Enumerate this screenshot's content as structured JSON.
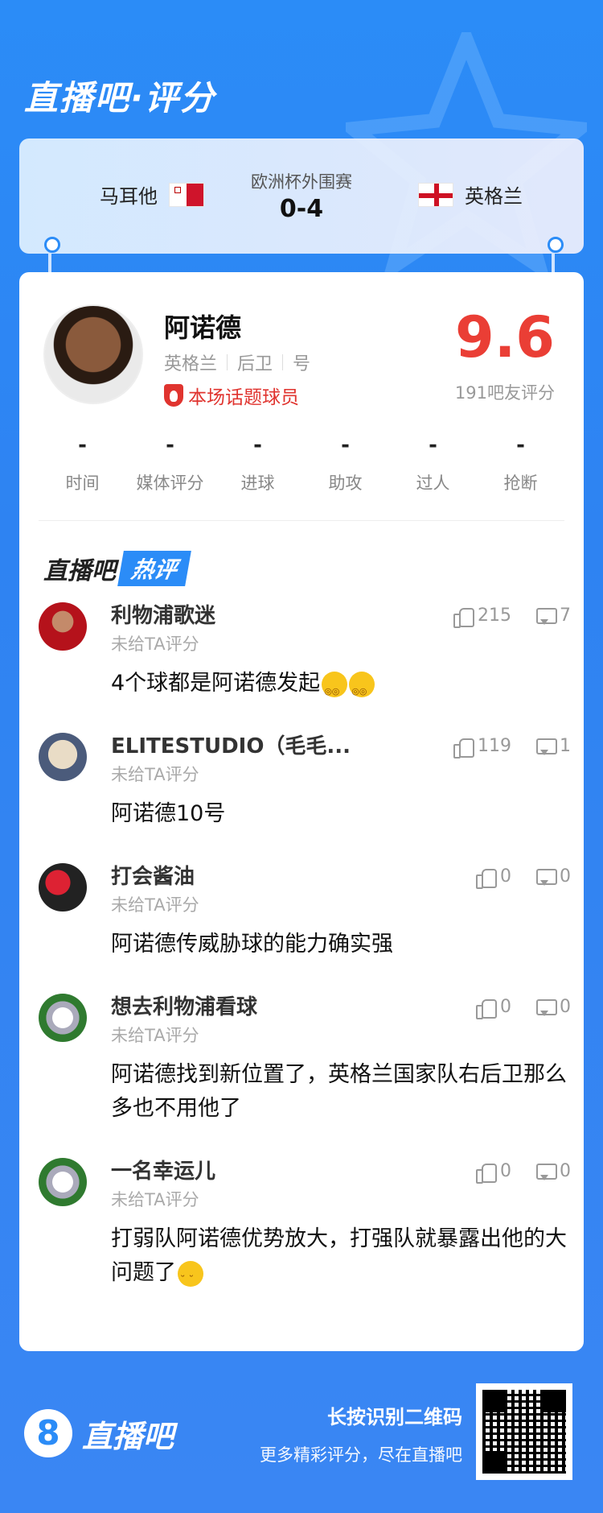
{
  "brand": {
    "title": "直播吧·评分"
  },
  "match": {
    "competition": "欧洲杯外围赛",
    "score": "0-4",
    "home": {
      "name": "马耳他",
      "flag": "flag-malta-icon"
    },
    "away": {
      "name": "英格兰",
      "flag": "flag-england-icon"
    }
  },
  "player": {
    "name": "阿诺德",
    "team": "英格兰",
    "position": "后卫",
    "number_label": "号",
    "hot_tag": "本场话题球员",
    "rating": "9.6",
    "rating_count": "191吧友评分"
  },
  "stats": [
    {
      "value": "-",
      "label": "时间"
    },
    {
      "value": "-",
      "label": "媒体评分"
    },
    {
      "value": "-",
      "label": "进球"
    },
    {
      "value": "-",
      "label": "助攻"
    },
    {
      "value": "-",
      "label": "过人"
    },
    {
      "value": "-",
      "label": "抢断"
    }
  ],
  "hot_header": {
    "part1": "直播吧",
    "part2": "热评"
  },
  "comments": [
    {
      "user": "利物浦歌迷",
      "sub": "未给TA评分",
      "text": "4个球都是阿诺德发起",
      "likes": "215",
      "replies": "7",
      "emoji": "dizzy-face-icon"
    },
    {
      "user": "ELITESTUDIO（毛毛...",
      "sub": "未给TA评分",
      "text": "阿诺德10号",
      "likes": "119",
      "replies": "1"
    },
    {
      "user": "打会酱油",
      "sub": "未给TA评分",
      "text": "阿诺德传威胁球的能力确实强",
      "likes": "0",
      "replies": "0"
    },
    {
      "user": "想去利物浦看球",
      "sub": "未给TA评分",
      "text": "阿诺德找到新位置了，英格兰国家队右后卫那么多也不用他了",
      "likes": "0",
      "replies": "0"
    },
    {
      "user": "一名幸运儿",
      "sub": "未给TA评分",
      "text": "打弱队阿诺德优势放大，打强队就暴露出他的大问题了",
      "likes": "0",
      "replies": "0",
      "emoji": "crying-face-icon"
    }
  ],
  "footer": {
    "logo_char": "8",
    "logo_name": "直播吧",
    "qr_title": "长按识别二维码",
    "qr_sub": "更多精彩评分，尽在直播吧"
  },
  "colors": {
    "accent": "#2b8cf7",
    "rating": "#ea3e35",
    "hot": "#e0342f"
  }
}
